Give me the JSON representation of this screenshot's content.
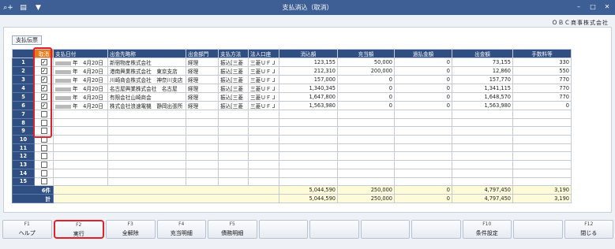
{
  "window": {
    "title": "支払消込（取消）"
  },
  "toolbar": {
    "icons": [
      "search-plus-icon",
      "pages-icon",
      "dropdown-icon"
    ],
    "search_glyph": "⌕+",
    "pages_glyph": "▤",
    "dropdown_glyph": "▼"
  },
  "window_controls": {
    "minimize": "–",
    "maximize": "□",
    "close": "✕"
  },
  "company": "ＯＢＣ商事株式会社",
  "tab": {
    "label": "支払伝票"
  },
  "table": {
    "headers": {
      "cancel": "取消",
      "date": "支払日付",
      "payee": "出金先略称",
      "dept": "出金部門",
      "method": "支払方法",
      "account": "法人口座",
      "applied": "消込額",
      "allocated": "充当額",
      "overpaid": "過払金額",
      "withdrawal": "出金額",
      "fee": "手数料等"
    },
    "rows": [
      {
        "no": "1",
        "checked": true,
        "date": "年　4月20日",
        "payee": "新宿物産株式会社",
        "dept": "経理",
        "method": "振込[三菱",
        "account": "三菱ＵＦＪ",
        "applied": "123,155",
        "allocated": "50,000",
        "overpaid": "0",
        "withdrawal": "73,155",
        "fee": "330"
      },
      {
        "no": "2",
        "checked": true,
        "date": "年　4月20日",
        "payee": "港南興業株式会社　東京支店",
        "dept": "経理",
        "method": "振込[三菱",
        "account": "三菱ＵＦＪ",
        "applied": "212,310",
        "allocated": "200,000",
        "overpaid": "0",
        "withdrawal": "12,860",
        "fee": "550"
      },
      {
        "no": "3",
        "checked": true,
        "date": "年　4月20日",
        "payee": "川崎商会株式会社　神奈川支店",
        "dept": "経理",
        "method": "振込[三菱",
        "account": "三菱ＵＦＪ",
        "applied": "157,000",
        "allocated": "0",
        "overpaid": "0",
        "withdrawal": "157,770",
        "fee": "770"
      },
      {
        "no": "4",
        "checked": true,
        "date": "年　4月20日",
        "payee": "名古屋興業株式会社　名古屋",
        "dept": "経理",
        "method": "振込[三菱",
        "account": "三菱ＵＦＪ",
        "applied": "1,340,345",
        "allocated": "0",
        "overpaid": "0",
        "withdrawal": "1,341,115",
        "fee": "770"
      },
      {
        "no": "5",
        "checked": true,
        "date": "年　4月20日",
        "payee": "有限会社山崎商会",
        "dept": "経理",
        "method": "振込[三菱",
        "account": "三菱ＵＦＪ",
        "applied": "1,647,800",
        "allocated": "0",
        "overpaid": "0",
        "withdrawal": "1,648,570",
        "fee": "770"
      },
      {
        "no": "6",
        "checked": true,
        "date": "年　4月20日",
        "payee": "株式会社浪速電機　静岡出張所",
        "dept": "経理",
        "method": "振込[三菱",
        "account": "三菱ＵＦＪ",
        "applied": "1,563,980",
        "allocated": "0",
        "overpaid": "0",
        "withdrawal": "1,563,980",
        "fee": "0"
      },
      {
        "no": "7",
        "checked": false
      },
      {
        "no": "8",
        "checked": false
      },
      {
        "no": "9",
        "checked": false
      },
      {
        "no": "10",
        "checked": false
      },
      {
        "no": "11",
        "checked": false
      },
      {
        "no": "12",
        "checked": false
      },
      {
        "no": "13",
        "checked": false
      },
      {
        "no": "14",
        "checked": false
      },
      {
        "no": "15",
        "checked": false
      }
    ],
    "footer": [
      {
        "label": "6件",
        "applied": "5,044,590",
        "allocated": "250,000",
        "overpaid": "0",
        "withdrawal": "4,797,450",
        "fee": "3,190"
      },
      {
        "label": "計",
        "applied": "5,044,590",
        "allocated": "250,000",
        "overpaid": "0",
        "withdrawal": "4,797,450",
        "fee": "3,190"
      }
    ]
  },
  "fkeys": [
    {
      "key": "F1",
      "label": "ヘルプ"
    },
    {
      "key": "F2",
      "label": "実行",
      "highlight": true
    },
    {
      "key": "F3",
      "label": "全解除"
    },
    {
      "key": "F4",
      "label": "充当明細"
    },
    {
      "key": "F5",
      "label": "債務明細"
    },
    {
      "key": "",
      "label": ""
    },
    {
      "key": "",
      "label": ""
    },
    {
      "key": "",
      "label": ""
    },
    {
      "key": "",
      "label": ""
    },
    {
      "key": "F10",
      "label": "条件設定"
    },
    {
      "key": "",
      "label": ""
    },
    {
      "key": "F12",
      "label": "閉じる"
    }
  ]
}
